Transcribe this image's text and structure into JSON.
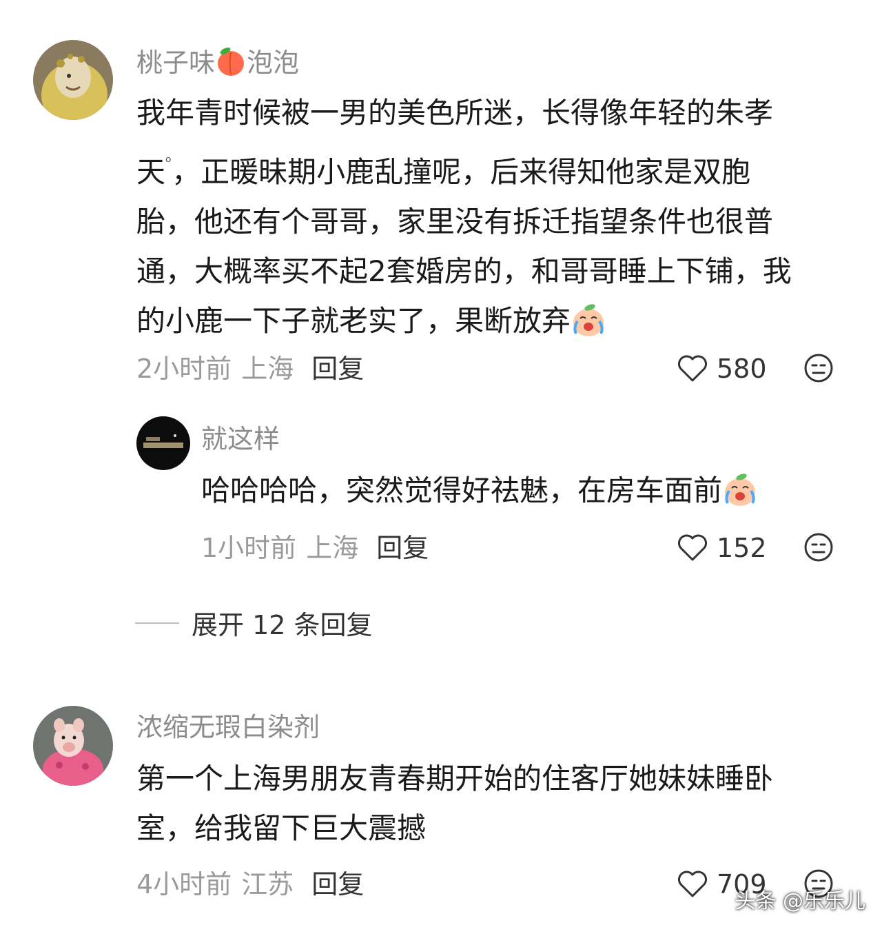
{
  "comments": [
    {
      "username": "桃子味🍑泡泡",
      "username_prefix": "桃子味",
      "username_suffix": "泡泡",
      "text_lines": [
        "我年青时候被一男的美色所迷，长得像年轻的朱孝",
        "天",
        "，正暖昧期小鹿乱撞呢，后来得知他家是双胞",
        "胎，他还有个哥哥，家里没有拆迁指望条件也很普",
        "通，大概率买不起2套婚房的，和哥哥睡上下铺，我",
        "的小鹿一下子就老实了，果断放弃"
      ],
      "time": "2小时前",
      "location": "上海",
      "reply_label": "回复",
      "likes": "580"
    },
    {
      "username": "就这样",
      "text": "哈哈哈哈，突然觉得好祛魅，在房车面前",
      "time": "1小时前",
      "location": "上海",
      "reply_label": "回复",
      "likes": "152"
    },
    {
      "username": "浓缩无瑕白染剂",
      "text_lines": [
        "第一个上海男朋友青春期开始的住客厅她妹妹睡卧",
        "室，给我留下巨大震撼"
      ],
      "time": "4小时前",
      "location": "江苏",
      "reply_label": "回复",
      "likes": "709"
    }
  ],
  "expand_label": "展开 12 条回复",
  "watermark": "头条 @乐乐儿",
  "icons": {
    "like": "heart-outline-icon",
    "dislike": "meh-face-icon",
    "emoji": "crying-laughing-peach-emoji",
    "search_hint": "search-superscript-icon"
  },
  "colors": {
    "username": "#8c8c8c",
    "text": "#1a1a1a",
    "meta": "#9a9a9a"
  }
}
